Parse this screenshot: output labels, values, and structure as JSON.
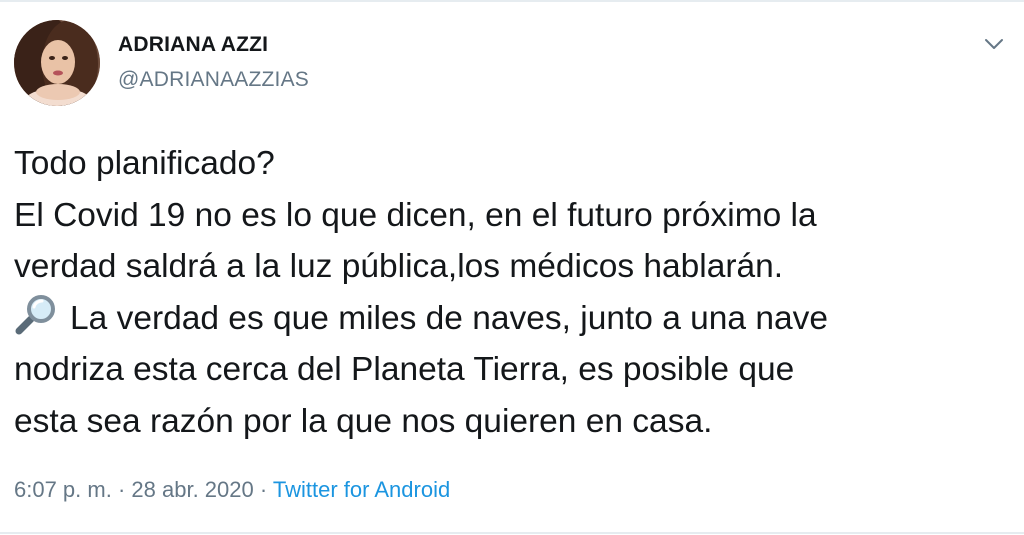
{
  "author": {
    "name": "ADRIANA AZZI",
    "handle": "@ADRIANAAZZIAS"
  },
  "tweet": {
    "lines": [
      "Todo planificado?",
      "El Covid 19 no es lo que dicen, en el futuro próximo la",
      "verdad saldrá a la luz pública,los médicos hablarán.",
      "La verdad es que miles de naves, junto a una nave",
      "nodriza esta cerca del Planeta Tierra, es posible que",
      "esta sea razón por la que nos quieren en casa."
    ]
  },
  "meta": {
    "time": "6:07 p. m.",
    "separator_1": " · ",
    "date": "28 abr. 2020",
    "separator_2": " · ",
    "source": "Twitter for Android"
  },
  "icons": {
    "menu": "chevron-down-icon",
    "emoji": "magnifying-glass-icon"
  },
  "colors": {
    "text": "#14171a",
    "secondary": "#657786",
    "link": "#1b95e0",
    "divider": "#e6ecf0"
  }
}
